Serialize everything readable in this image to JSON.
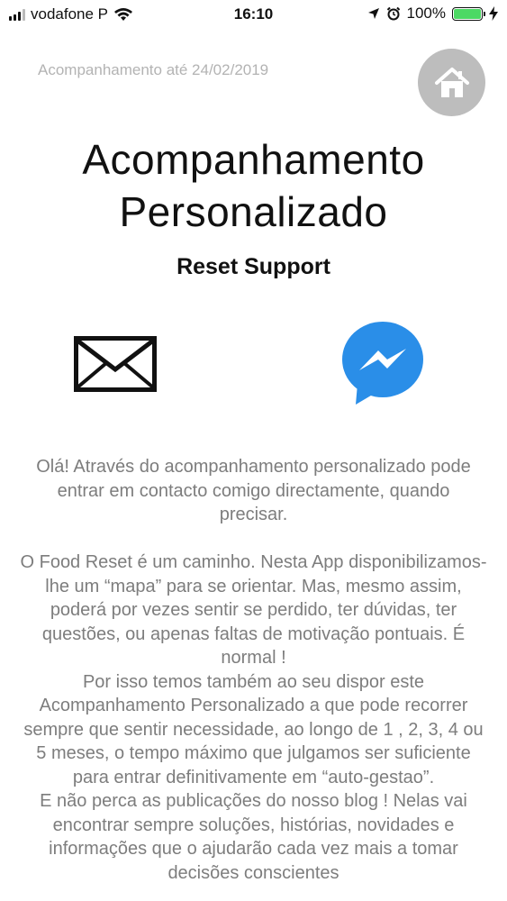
{
  "status_bar": {
    "carrier": "vodafone P",
    "time": "16:10",
    "battery": "100%"
  },
  "header": {
    "follow_up_date": "Acompanhamento até 24/02/2019",
    "home_icon": "home-icon"
  },
  "title": {
    "line1": "Acompanhamento",
    "line2": "Personalizado",
    "subtitle": "Reset Support"
  },
  "contact": {
    "email_icon": "envelope-icon",
    "messenger_icon": "messenger-icon",
    "messenger_color": "#2a8ee8"
  },
  "content": {
    "intro": "Olá! Através do acompanhamento personalizado pode entrar em contacto comigo directamente, quando precisar.",
    "paragraph1": "O Food Reset é um caminho. Nesta App disponibilizamos-lhe um “mapa” para se orientar. Mas, mesmo assim, poderá por vezes sentir se perdido, ter dúvidas, ter questões, ou apenas faltas de motivação pontuais. É normal !",
    "paragraph2": "Por isso temos também ao seu dispor este Acompanhamento Personalizado a que pode recorrer sempre que sentir necessidade, ao longo de 1 , 2, 3, 4 ou 5 meses, o tempo máximo que julgamos ser suficiente para entrar definitivamente em “auto-gestao”.",
    "paragraph3": "E não perca as publicações do nosso blog ! Nelas vai encontrar sempre soluções, histórias, novidades e informações que o ajudarão cada vez mais a tomar decisões conscientes"
  }
}
